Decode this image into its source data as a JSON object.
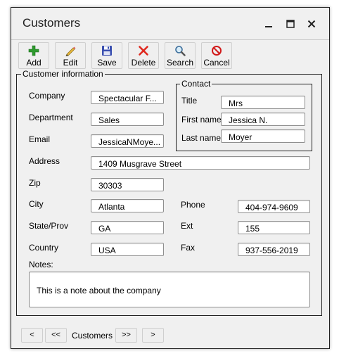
{
  "window": {
    "title": "Customers"
  },
  "controls": {
    "minimize": "—",
    "maximize": "☐",
    "close": "✕"
  },
  "toolbar": {
    "add": {
      "label": "Add",
      "icon": "plus-icon"
    },
    "edit": {
      "label": "Edit",
      "icon": "pencil-icon"
    },
    "save": {
      "label": "Save",
      "icon": "floppy-disk-icon"
    },
    "delete": {
      "label": "Delete",
      "icon": "red-x-icon"
    },
    "search": {
      "label": "Search",
      "icon": "magnifier-icon"
    },
    "cancel": {
      "label": "Cancel",
      "icon": "no-entry-icon"
    }
  },
  "customer_info": {
    "title": "Customer information",
    "company": {
      "label": "Company",
      "value": "Spectacular F..."
    },
    "department": {
      "label": "Department",
      "value": "Sales"
    },
    "email": {
      "label": "Email",
      "value": "JessicaNMoye..."
    },
    "address": {
      "label": "Address",
      "value": "1409 Musgrave Street"
    },
    "zip": {
      "label": "Zip",
      "value": "30303"
    },
    "city": {
      "label": "City",
      "value": "Atlanta"
    },
    "state": {
      "label": "State/Prov",
      "value": "GA"
    },
    "country": {
      "label": "Country",
      "value": "USA"
    },
    "phone": {
      "label": "Phone",
      "value": "404-974-9609"
    },
    "ext": {
      "label": "Ext",
      "value": "155"
    },
    "fax": {
      "label": "Fax",
      "value": "937-556-2019"
    },
    "notes": {
      "label": "Notes:",
      "value": "This is a note about the company"
    }
  },
  "contact": {
    "title": "Contact",
    "title_field": {
      "label": "Title",
      "value": "Mrs"
    },
    "first_name": {
      "label": "First name",
      "value": "Jessica N."
    },
    "last_name": {
      "label": "Last name",
      "value": "Moyer"
    }
  },
  "nav": {
    "first": "<",
    "prev": "<<",
    "label": "Customers",
    "next": ">>",
    "last": ">"
  },
  "colors": {
    "add_green": "#2e9a2e",
    "delete_red": "#e0281e",
    "save_blue": "#3a4fb0",
    "cancel_red": "#d11a1a"
  }
}
